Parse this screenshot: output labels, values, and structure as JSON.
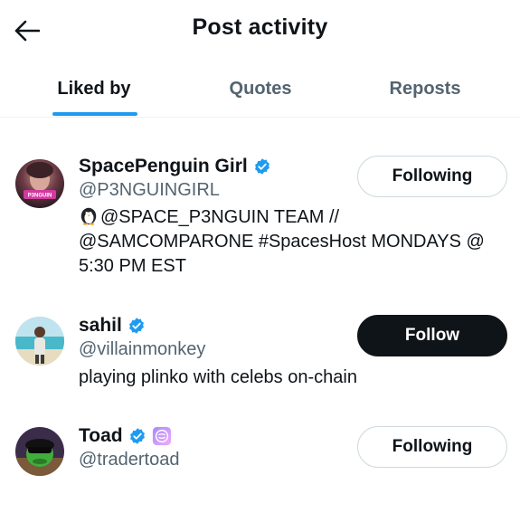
{
  "header": {
    "title": "Post activity",
    "back_icon": "arrow-left-icon"
  },
  "tabs": [
    {
      "label": "Liked by",
      "active": true
    },
    {
      "label": "Quotes",
      "active": false
    },
    {
      "label": "Reposts",
      "active": false
    }
  ],
  "colors": {
    "accent": "#1d9bf0",
    "text_primary": "#0f1419",
    "text_secondary": "#536471",
    "border": "#cfd9de",
    "verified": "#1d9bf0"
  },
  "users": [
    {
      "name": "SpacePenguin Girl",
      "handle": "@P3NGUINGIRL",
      "verified": true,
      "bio": "@SPACE_P3NGUIN TEAM // @SAMCOMPARONE #SpacesHost MONDAYS @ 5:30 PM EST",
      "bio_emoji": "penguin-emoji",
      "avatar_text": "P3NGUIN",
      "button": "Following"
    },
    {
      "name": "sahil",
      "handle": "@villainmonkey",
      "verified": true,
      "bio": "playing plinko with celebs on-chain",
      "button": "Follow"
    },
    {
      "name": "Toad",
      "handle": "@tradertoad",
      "verified": true,
      "affiliate_badge": "affiliate-badge-icon",
      "button": "Following"
    }
  ]
}
